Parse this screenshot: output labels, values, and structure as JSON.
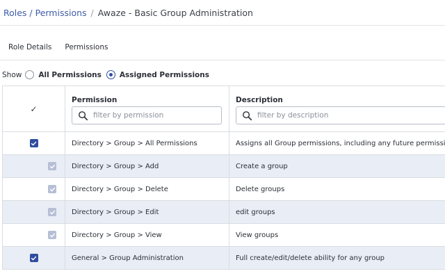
{
  "breadcrumb": {
    "link": "Roles / Permissions",
    "separator": "/",
    "current": "Awaze - Basic Group Administration"
  },
  "tabs": [
    {
      "label": "Role Details"
    },
    {
      "label": "Permissions"
    }
  ],
  "show_filter": {
    "label": "Show",
    "options": [
      {
        "label": "All Permissions",
        "selected": false
      },
      {
        "label": "Assigned Permissions",
        "selected": true
      }
    ]
  },
  "table": {
    "header_check_glyph": "✓",
    "columns": {
      "permission": {
        "title": "Permission",
        "filter_placeholder": "filter by permission",
        "filter_value": ""
      },
      "description": {
        "title": "Description",
        "filter_placeholder": "filter by description",
        "filter_value": ""
      }
    },
    "rows": [
      {
        "permission": "Directory > Group > All Permissions",
        "description": "Assigns all Group permissions, including any future permissions",
        "checked": true,
        "inherited": false
      },
      {
        "permission": "Directory > Group > Add",
        "description": "Create a group",
        "checked": true,
        "inherited": true
      },
      {
        "permission": "Directory > Group > Delete",
        "description": "Delete groups",
        "checked": true,
        "inherited": true
      },
      {
        "permission": "Directory > Group > Edit",
        "description": "edit groups",
        "checked": true,
        "inherited": true
      },
      {
        "permission": "Directory > Group > View",
        "description": "View groups",
        "checked": true,
        "inherited": true
      },
      {
        "permission": "General > Group Administration",
        "description": "Full create/edit/delete ability for any group",
        "checked": true,
        "inherited": false
      }
    ]
  },
  "colors": {
    "link": "#3d5ba8",
    "accent": "#2f4d9e",
    "inherited_check": "#b7bfd6",
    "alt_row": "#e9edf5"
  },
  "icons": {
    "filter": "search-icon",
    "checkbox": "checkmark-icon"
  }
}
